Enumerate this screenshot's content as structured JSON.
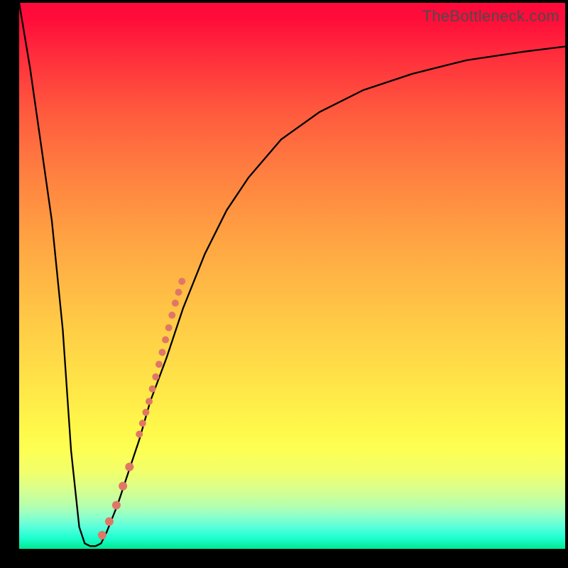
{
  "watermark": "TheBottleneck.com",
  "chart_data": {
    "type": "line",
    "title": "",
    "xlabel": "",
    "ylabel": "",
    "xlim": [
      0,
      100
    ],
    "ylim": [
      0,
      100
    ],
    "grid": false,
    "legend": false,
    "series": [
      {
        "name": "curve",
        "type": "line",
        "x": [
          0,
          2,
          4,
          6,
          8,
          9.5,
          11,
          12,
          13,
          14,
          15,
          16,
          18,
          20,
          22,
          24,
          27,
          30,
          34,
          38,
          42,
          48,
          55,
          63,
          72,
          82,
          92,
          100
        ],
        "y": [
          100,
          88,
          74,
          60,
          40,
          18,
          4,
          1,
          0.5,
          0.5,
          1,
          3,
          8,
          14,
          20,
          27,
          35,
          44,
          54,
          62,
          68,
          75,
          80,
          84,
          87,
          89.5,
          91,
          92
        ]
      },
      {
        "name": "dense-segment",
        "type": "scatter",
        "x": [
          22.0,
          22.6,
          23.2,
          23.8,
          24.4,
          25.0,
          25.6,
          26.2,
          26.8,
          27.4,
          28.0,
          28.6,
          29.2,
          29.8
        ],
        "y": [
          21.0,
          23.0,
          25.0,
          27.0,
          29.3,
          31.5,
          33.8,
          36.0,
          38.3,
          40.5,
          42.8,
          45.0,
          47.0,
          49.0
        ],
        "marker_radius": 5
      },
      {
        "name": "sparse-dots",
        "type": "scatter",
        "x": [
          20.2,
          19.0,
          17.8,
          16.5,
          15.2
        ],
        "y": [
          15.0,
          11.5,
          8.0,
          5.0,
          2.5
        ],
        "marker_radius": 6
      }
    ],
    "marker_color": "#e07766",
    "line_color": "#000000"
  }
}
